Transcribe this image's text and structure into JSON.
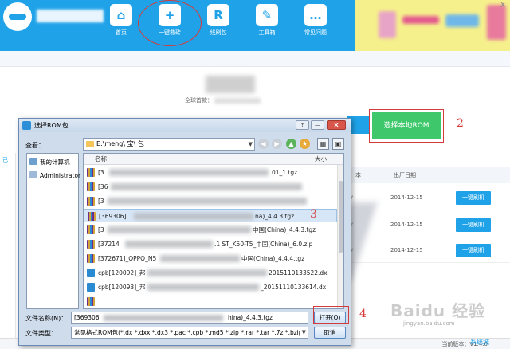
{
  "app": {
    "nav": [
      {
        "label": "首页",
        "icon": "home-icon",
        "glyph": "⌂"
      },
      {
        "label": "一键救砖",
        "icon": "shield-plus-icon",
        "glyph": "+"
      },
      {
        "label": "线刷包",
        "icon": "cloud-r-icon",
        "glyph": "R"
      },
      {
        "label": "工具箱",
        "icon": "wrench-icon",
        "glyph": "✎"
      },
      {
        "label": "常见问题",
        "icon": "chat-bubble-icon",
        "glyph": "…"
      }
    ],
    "subtitle_prefix": "全球首款",
    "select_local_rom": "选择本地ROM",
    "table_header_col1": "本",
    "table_header_col2": "出厂日期",
    "rows": [
      {
        "marker": "#",
        "date": "2014-12-15",
        "action": "一键刷机"
      },
      {
        "marker": "#",
        "date": "2014-12-15",
        "action": "一键刷机"
      },
      {
        "marker": "#",
        "date": "2014-12-15",
        "action": "一键刷机"
      }
    ],
    "left_tab": "已",
    "left_warn": "▲ 鼠",
    "version": "当前版本：V1.4.0",
    "brand_corner": "系统城",
    "watermark": "Baidu 经验",
    "watermark_url": "jingyan.baidu.com",
    "accent_color": "#1fa2e8",
    "green_color": "#3ec86b"
  },
  "annotations": {
    "two": "2",
    "three": "3",
    "four": "4"
  },
  "dialog": {
    "title": "选择ROM包",
    "help": "?",
    "close": "X",
    "minimize": "—",
    "look_in_label": "查看：",
    "look_in_path": "E:\\meng\\    宝\\    包",
    "places": [
      "我的计算机",
      "Administrator"
    ],
    "columns": {
      "name": "名称",
      "size": "大小"
    },
    "files": [
      {
        "name": "[3",
        "tail": "01_1.tgz",
        "type": "tgz",
        "selected": false
      },
      {
        "name": "[36",
        "tail": "",
        "type": "tgz",
        "selected": false
      },
      {
        "name": "[3",
        "tail": "",
        "type": "tgz",
        "selected": false
      },
      {
        "name": "[369306]",
        "tail": "na)_4.4.3.tgz",
        "type": "tgz",
        "selected": true
      },
      {
        "name": "[3",
        "tail": "中国(China)_4.4.3.tgz",
        "type": "tgz",
        "selected": false
      },
      {
        "name": "[37214",
        "tail": ".1 ST_K50-T5_中国(China)_6.0.zip",
        "type": "zip",
        "selected": false
      },
      {
        "name": "[372671]_OPPO_N5",
        "tail": "中国(China)_4.4.4.tgz",
        "type": "tgz",
        "selected": false
      },
      {
        "name": "cpb[120092]_邦",
        "tail": "2015110133522.dx",
        "type": "dx",
        "selected": false
      },
      {
        "name": "cpb[120093]_邦",
        "tail": "_20151110133614.dx",
        "type": "dx",
        "selected": false
      },
      {
        "name": "",
        "tail": "",
        "type": "tgz",
        "selected": false
      }
    ],
    "filename_label": "文件名称(N)：",
    "filename_value": "[369306",
    "filename_tail": "hina)_4.4.3.tgz",
    "filetype_label": "文件类型：",
    "filetype_value": "常见格式ROM包(*.dx *.dxx *.dx3 *.pac *.cpb *.md5 *.zip *.rar *.tar *.7z *.bzip2",
    "open_button": "打开(O)",
    "cancel_button": "取消"
  }
}
